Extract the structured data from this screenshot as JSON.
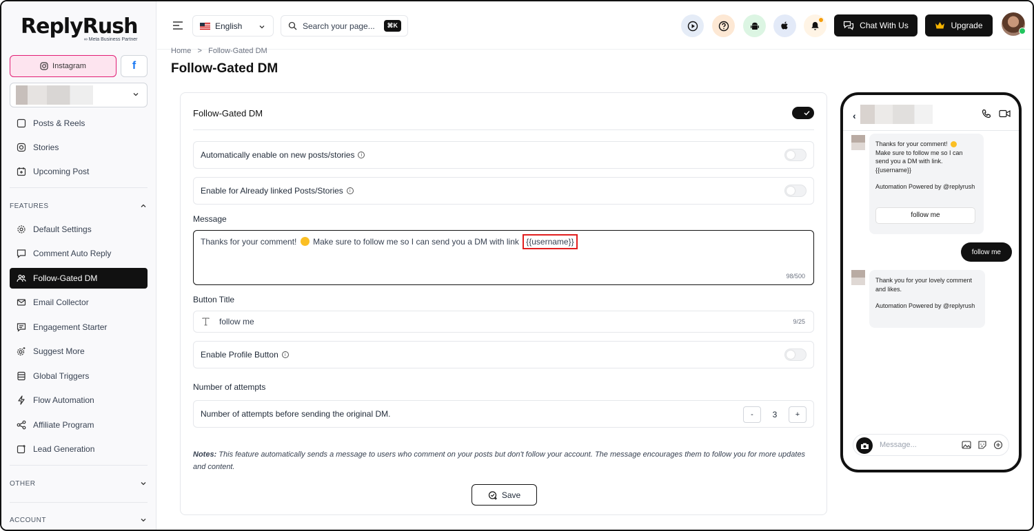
{
  "brand": {
    "name": "ReplyRush",
    "partner": "∞ Meta Business Partner"
  },
  "sidebar": {
    "instagram_label": "Instagram",
    "facebook_label": "f",
    "top_items": [
      {
        "label": "Posts & Reels"
      },
      {
        "label": "Stories"
      },
      {
        "label": "Upcoming Post"
      }
    ],
    "features_label": "FEATURES",
    "features": [
      {
        "label": "Default Settings"
      },
      {
        "label": "Comment Auto Reply"
      },
      {
        "label": "Follow-Gated DM"
      },
      {
        "label": "Email Collector"
      },
      {
        "label": "Engagement Starter"
      },
      {
        "label": "Suggest More"
      },
      {
        "label": "Global Triggers"
      },
      {
        "label": "Flow Automation"
      },
      {
        "label": "Affiliate Program"
      },
      {
        "label": "Lead Generation"
      }
    ],
    "other_label": "OTHER",
    "account_label": "ACCOUNT"
  },
  "header": {
    "language": "English",
    "search_placeholder": "Search your page...",
    "shortcut": "⌘K",
    "chat_label": "Chat With Us",
    "upgrade_label": "Upgrade"
  },
  "breadcrumb": {
    "home": "Home",
    "sep": ">",
    "current": "Follow-Gated DM"
  },
  "page_title": "Follow-Gated DM",
  "card": {
    "title": "Follow-Gated DM",
    "auto_enable_label": "Automatically enable on new posts/stories",
    "already_linked_label": "Enable for Already linked Posts/Stories",
    "message_label": "Message",
    "message_text": "Thanks for your comment!",
    "message_text_2": "Make sure to follow me so I can send you a DM with link",
    "message_var": "{{username}}",
    "message_count": "98/500",
    "button_title_label": "Button Title",
    "button_title_value": "follow me",
    "button_title_count": "9/25",
    "profile_button_label": "Enable Profile Button",
    "attempts_label": "Number of attempts",
    "attempts_row_label": "Number of attempts before sending the original DM.",
    "attempts_value": "3",
    "minus": "-",
    "plus": "+",
    "notes_bold": "Notes:",
    "notes_text": "This feature automatically sends a message to users who comment on your posts but don't follow your account. The message encourages them to follow you for more updates and content.",
    "save_label": "Save"
  },
  "phone": {
    "bubble1_line1": "Thanks for your comment!",
    "bubble1_line2": "Make sure to follow me so I can send you a DM with link. {{username}}",
    "bubble1_powered": "Automation Powered by @replyrush",
    "bubble1_button": "follow me",
    "sent_label": "follow me",
    "bubble2_line1": "Thank you for your lovely comment and likes.",
    "bubble2_powered": "Automation Powered by @replyrush",
    "input_placeholder": "Message..."
  },
  "colors": {
    "accent": "#111111",
    "instagram": "#e11d74",
    "facebook": "#1877f2",
    "highlight": "#e11d1d"
  }
}
